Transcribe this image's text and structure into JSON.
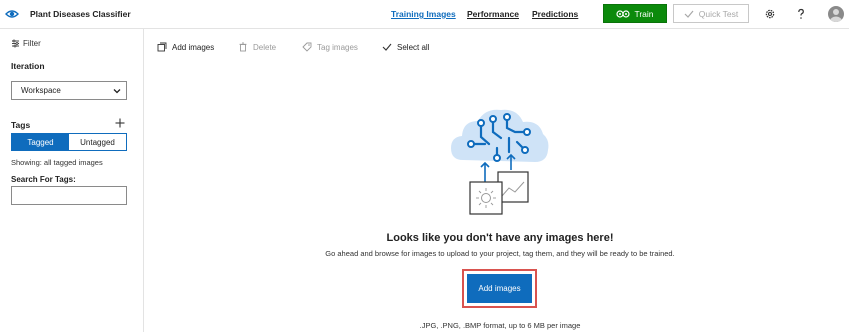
{
  "app": {
    "title": "Plant Diseases Classifier"
  },
  "nav": {
    "tabs": [
      {
        "label": "Training Images",
        "active": true
      },
      {
        "label": "Performance",
        "active": false
      },
      {
        "label": "Predictions",
        "active": false
      }
    ],
    "train_label": "Train",
    "quick_test_label": "Quick Test"
  },
  "icons": {
    "logo": "eye-logo-icon",
    "train": "gears-icon",
    "quick_test": "check-icon",
    "settings": "gear-icon",
    "help": "question-icon",
    "avatar": "user-avatar"
  },
  "sidebar": {
    "filter_label": "Filter",
    "iteration_label": "Iteration",
    "iteration_value": "Workspace",
    "tags_label": "Tags",
    "tag_modes": [
      "Tagged",
      "Untagged"
    ],
    "selected_tag_mode": "Tagged",
    "showing_text": "Showing: all tagged images",
    "search_label": "Search For Tags:",
    "search_value": ""
  },
  "toolbar": {
    "add_images": "Add images",
    "delete": "Delete",
    "tag_images": "Tag images",
    "select_all": "Select all"
  },
  "empty_state": {
    "title": "Looks like you don't have any images here!",
    "description": "Go ahead and browse for images to upload to your project, tag them, and they will be ready to be trained.",
    "button_label": "Add images",
    "format_note": ".JPG, .PNG, .BMP format, up to 6 MB per image"
  },
  "colors": {
    "accent": "#0f6cbd",
    "train_green": "#0b8a0b",
    "highlight_red": "#d9534f",
    "illustration_bg": "#cfe3f7"
  }
}
